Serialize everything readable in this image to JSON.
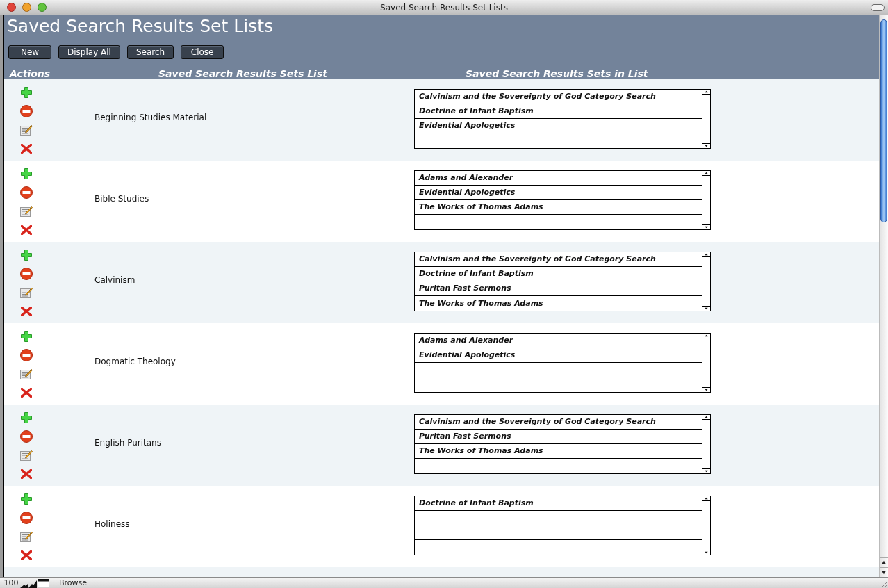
{
  "window": {
    "title": "Saved Search Results Set Lists"
  },
  "header": {
    "title": "Saved Search Results Set Lists",
    "buttons": [
      "New",
      "Display All",
      "Search",
      "Close"
    ],
    "columns": [
      "Actions",
      "Saved Search Results Sets List",
      "Saved Search Results Sets in List"
    ]
  },
  "records": [
    {
      "name": "Beginning Studies Material",
      "sets": [
        "Calvinism and the Sovereignty of God Category Search",
        "Doctrine of Infant Baptism",
        "Evidential Apologetics"
      ]
    },
    {
      "name": "Bible Studies",
      "sets": [
        "Adams and Alexander",
        "Evidential Apologetics",
        "The Works of Thomas Adams"
      ]
    },
    {
      "name": "Calvinism",
      "sets": [
        "Calvinism and the Sovereignty of God Category Search",
        "Doctrine of Infant Baptism",
        "Puritan Fast Sermons",
        "The Works of Thomas Adams"
      ]
    },
    {
      "name": "Dogmatic Theology",
      "sets": [
        "Adams and Alexander",
        "Evidential Apologetics"
      ]
    },
    {
      "name": "English Puritans",
      "sets": [
        "Calvinism and the Sovereignty of God Category Search",
        "Puritan Fast Sermons",
        "The Works of Thomas Adams"
      ]
    },
    {
      "name": "Holiness",
      "sets": [
        "Doctrine of Infant Baptism"
      ]
    }
  ],
  "status_bar": {
    "zoom": "100",
    "mode": "Browse"
  }
}
